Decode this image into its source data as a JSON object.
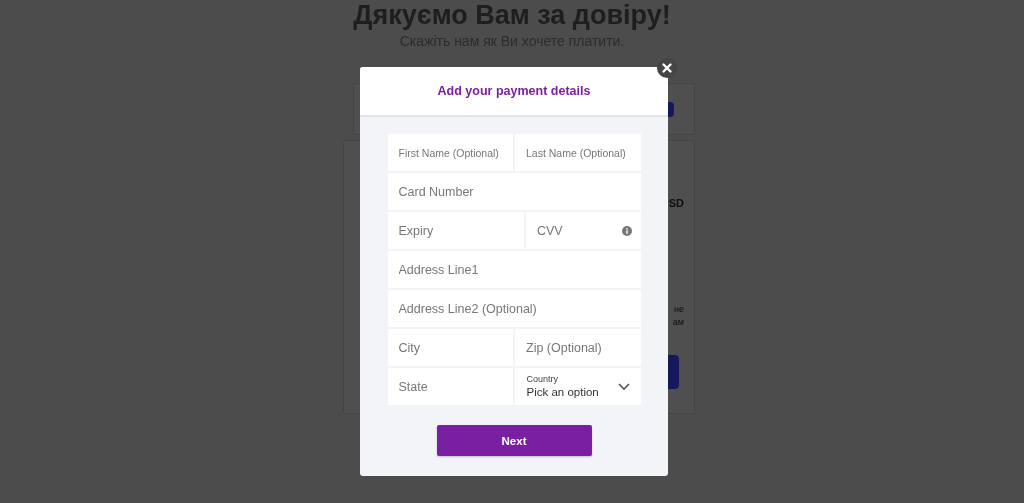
{
  "background": {
    "title": "Дякуємо Вам за довіру!",
    "subtitle": "Скажіть нам як Ви хочете платити.",
    "card_texts": [
      "SD",
      "не",
      "ам"
    ]
  },
  "modal": {
    "title": "Add your payment details",
    "rows": [
      [
        {
          "kind": "compact",
          "placeholder": "First Name (Optional)"
        },
        {
          "kind": "compact",
          "placeholder": "Last Name (Optional)"
        }
      ],
      [
        {
          "kind": "text",
          "placeholder": "Card Number"
        }
      ],
      [
        {
          "kind": "text",
          "placeholder": "Expiry"
        },
        {
          "kind": "text",
          "placeholder": "CVV",
          "info": true
        }
      ],
      [
        {
          "kind": "text",
          "placeholder": "Address Line1"
        }
      ],
      [
        {
          "kind": "text",
          "placeholder": "Address Line2 (Optional)"
        }
      ],
      [
        {
          "kind": "text",
          "placeholder": "City"
        },
        {
          "kind": "text",
          "placeholder": "Zip (Optional)"
        }
      ],
      [
        {
          "kind": "text",
          "placeholder": "State"
        },
        {
          "kind": "select",
          "label": "Country",
          "placeholder": "Pick an option"
        }
      ]
    ],
    "button": "Next"
  }
}
